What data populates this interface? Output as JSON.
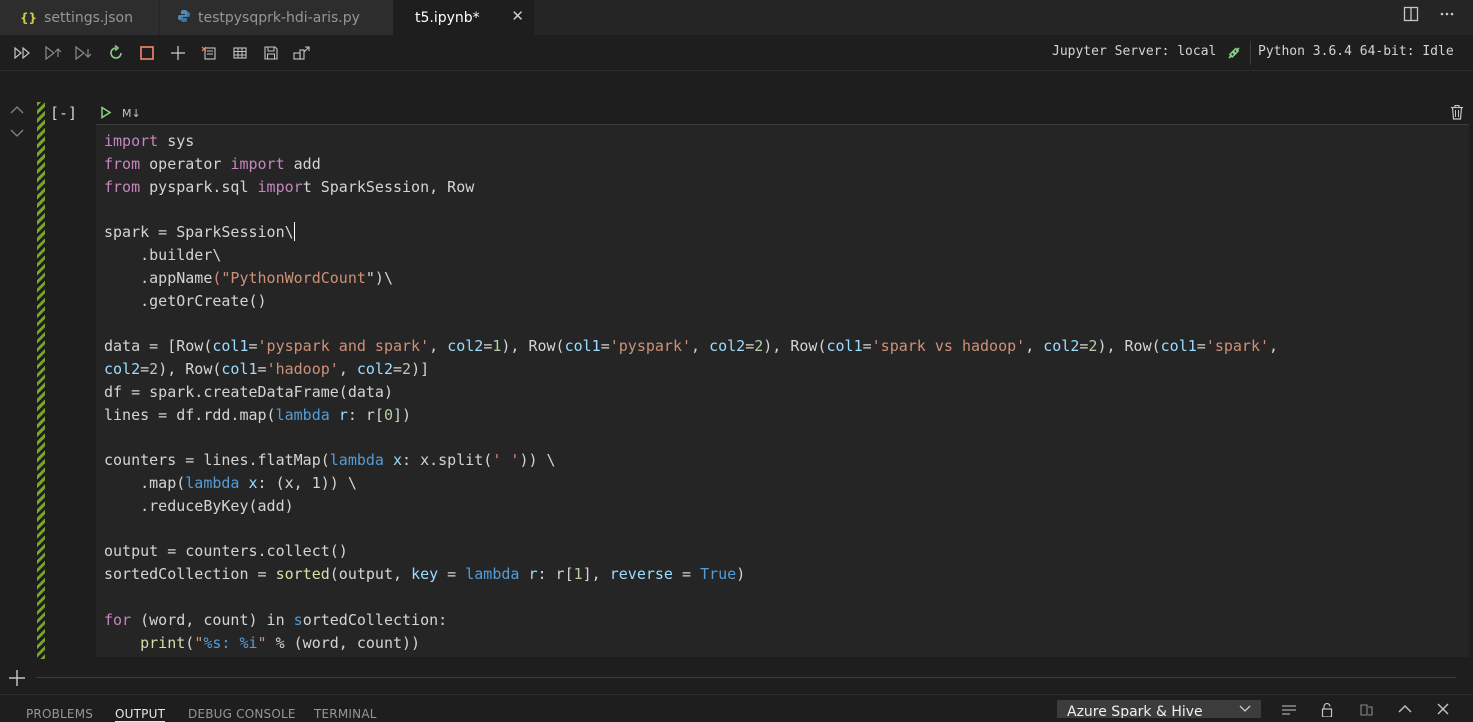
{
  "tabs": [
    {
      "label": "settings.json",
      "icon": "json-braces-icon",
      "icon_text": "{}",
      "icon_color": "#cbcb41"
    },
    {
      "label": "testpysqprk-hdi-aris.py",
      "icon": "python-icon",
      "icon_color": "#4b8bbe"
    },
    {
      "label": "t5.ipynb*",
      "active": true
    }
  ],
  "close_glyph": "✕",
  "toolbar": {
    "server_status": "Jupyter Server: local",
    "kernel_status": "Python 3.6.4 64-bit: Idle"
  },
  "cell": {
    "execution_count": "[-]",
    "cell_type_label": "M↓"
  },
  "code_lines": [
    "import sys",
    "from operator import add",
    "from pyspark.sql import SparkSession, Row",
    "",
    "spark = SparkSession\\",
    "    .builder\\",
    "    .appName(\"PythonWordCount\")\\",
    "    .getOrCreate()",
    "",
    "data = [Row(col1='pyspark and spark', col2=1), Row(col1='pyspark', col2=2), Row(col1='spark vs hadoop', col2=2), Row(col1='spark',",
    "col2=2), Row(col1='hadoop', col2=2)]",
    "df = spark.createDataFrame(data)",
    "lines = df.rdd.map(lambda r: r[0])",
    "",
    "counters = lines.flatMap(lambda x: x.split(' ')) \\",
    "    .map(lambda x: (x, 1)) \\",
    "    .reduceByKey(add)",
    "",
    "output = counters.collect()",
    "sortedCollection = sorted(output, key = lambda r: r[1], reverse = True)",
    "",
    "for (word, count) in sortedCollection:",
    "    print(\"%s: %i\" % (word, count))"
  ],
  "panel": {
    "tabs": [
      "PROBLEMS",
      "OUTPUT",
      "DEBUG CONSOLE",
      "TERMINAL"
    ],
    "active_tab": "OUTPUT",
    "output_channel": "Azure Spark & Hive"
  },
  "colors": {
    "accent_green": "#89d185",
    "cell_bar": "#79a42a",
    "stop_red": "#f48771"
  }
}
